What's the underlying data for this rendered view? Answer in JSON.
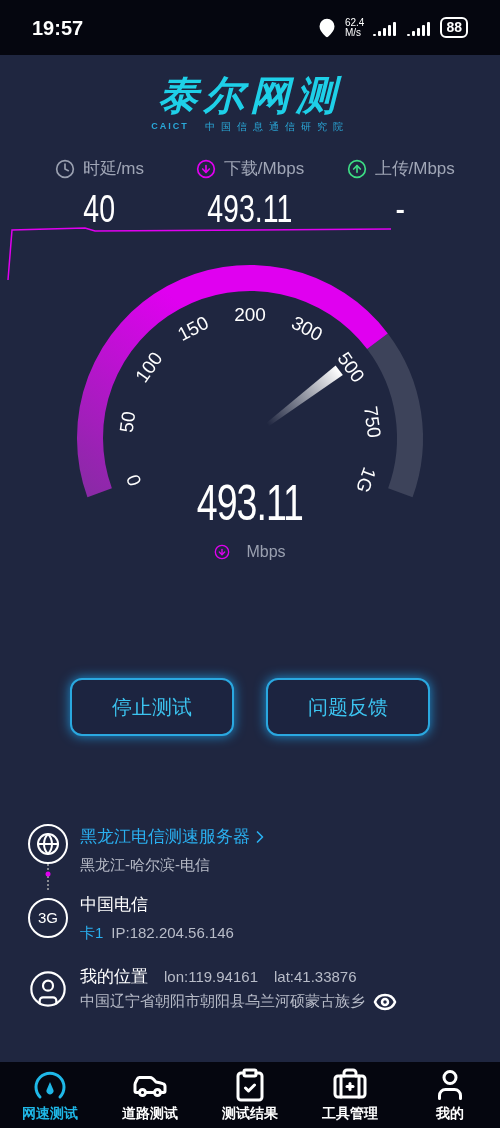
{
  "status_bar": {
    "time": "19:57",
    "net_speed": "62.4",
    "net_speed_unit": "M/s",
    "battery": "88"
  },
  "logo": {
    "title": "泰尔网测",
    "brand": "CAICT",
    "subtitle": "中国信息通信研究院"
  },
  "stats": [
    {
      "kind": "latency",
      "label": "时延/ms",
      "value": "40"
    },
    {
      "kind": "download",
      "label": "下载/Mbps",
      "value": "493.11"
    },
    {
      "kind": "upload",
      "label": "上传/Mbps",
      "value": "-"
    }
  ],
  "gauge": {
    "ticks": [
      "0",
      "50",
      "100",
      "150",
      "200",
      "300",
      "500",
      "750",
      "1G"
    ],
    "reading": "493.11",
    "unit": "Mbps"
  },
  "buttons": [
    "停止测试",
    "问题反馈"
  ],
  "server": {
    "name": "黑龙江电信测速服务器",
    "location": "黑龙江-哈尔滨-电信"
  },
  "carrier": {
    "network": "3G",
    "name": "中国电信",
    "sim": "卡1",
    "ip": "IP:182.204.56.146"
  },
  "location": {
    "title": "我的位置",
    "lon": "lon:119.94161",
    "lat": "lat:41.33876",
    "address": "中国辽宁省朝阳市朝阳县乌兰河硕蒙古族乡"
  },
  "nav": [
    {
      "kind": "speed",
      "label": "网速测试",
      "selected": true
    },
    {
      "kind": "road",
      "label": "道路测试",
      "selected": false
    },
    {
      "kind": "results",
      "label": "测试结果",
      "selected": false
    },
    {
      "kind": "tools",
      "label": "工具管理",
      "selected": false
    },
    {
      "kind": "me",
      "label": "我的",
      "selected": false
    }
  ]
}
